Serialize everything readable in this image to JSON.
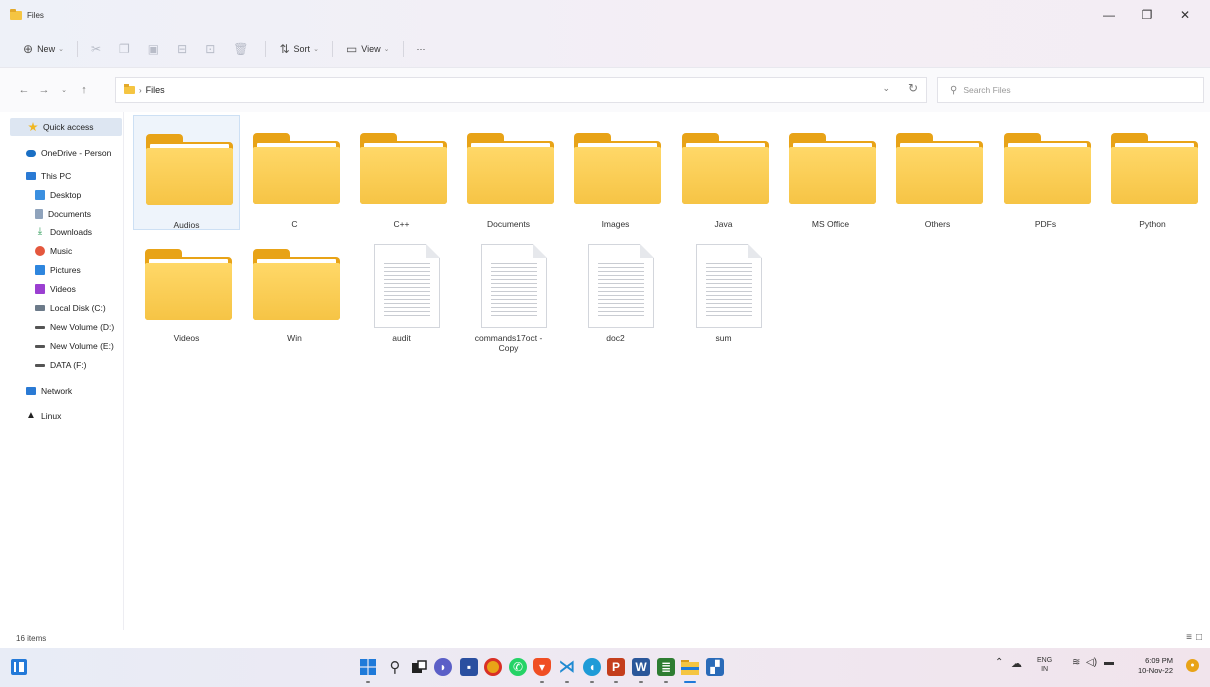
{
  "window": {
    "title": "Files",
    "minimize": "—",
    "maximize": "❐",
    "close": "✕"
  },
  "toolbar": {
    "new_label": "New",
    "sort_label": "Sort",
    "view_label": "View",
    "more_label": "···"
  },
  "address": {
    "breadcrumb": "Files",
    "search_placeholder": "Search Files"
  },
  "sidebar": {
    "items": [
      {
        "label": "Quick access"
      },
      {
        "label": "OneDrive - Person"
      },
      {
        "label": "This PC"
      },
      {
        "label": "Desktop"
      },
      {
        "label": "Documents"
      },
      {
        "label": "Downloads"
      },
      {
        "label": "Music"
      },
      {
        "label": "Pictures"
      },
      {
        "label": "Videos"
      },
      {
        "label": "Local Disk (C:)"
      },
      {
        "label": "New Volume (D:)"
      },
      {
        "label": "New Volume (E:)"
      },
      {
        "label": "DATA (F:)"
      },
      {
        "label": "Network"
      },
      {
        "label": "Linux"
      }
    ]
  },
  "files": [
    {
      "name": "Audios",
      "type": "folder",
      "selected": true
    },
    {
      "name": "C",
      "type": "folder"
    },
    {
      "name": "C++",
      "type": "folder"
    },
    {
      "name": "Documents",
      "type": "folder"
    },
    {
      "name": "Images",
      "type": "folder"
    },
    {
      "name": "Java",
      "type": "folder"
    },
    {
      "name": "MS Office",
      "type": "folder"
    },
    {
      "name": "Others",
      "type": "folder"
    },
    {
      "name": "PDFs",
      "type": "folder"
    },
    {
      "name": "Python",
      "type": "folder"
    },
    {
      "name": "Videos",
      "type": "folder"
    },
    {
      "name": "Win",
      "type": "folder"
    },
    {
      "name": "audit",
      "type": "file"
    },
    {
      "name": "commands17oct - Copy",
      "type": "file"
    },
    {
      "name": "doc2",
      "type": "file"
    },
    {
      "name": "sum",
      "type": "file"
    }
  ],
  "status": {
    "item_count": "16 items"
  },
  "taskbar": {
    "lang_top": "ENG",
    "lang_bottom": "IN",
    "time": "6:09 PM",
    "date": "10-Nov-22"
  }
}
